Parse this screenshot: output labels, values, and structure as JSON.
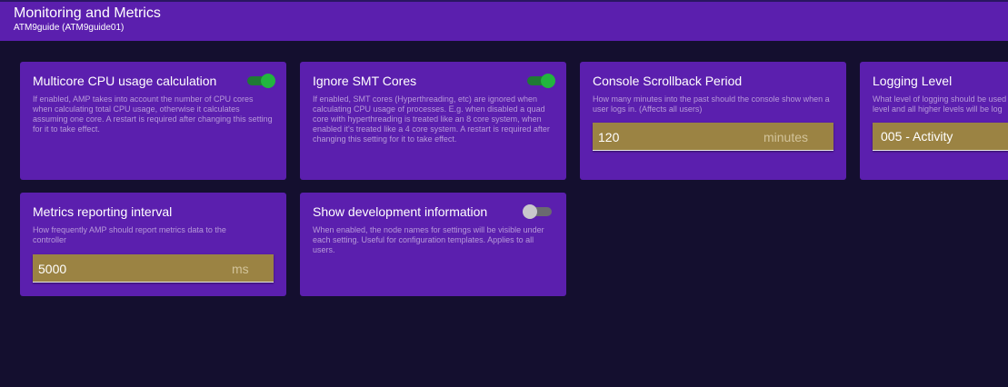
{
  "header": {
    "title": "Monitoring and Metrics",
    "subtitle": "ATM9guide (ATM9guide01)"
  },
  "settings": {
    "multicore_cpu": {
      "title": "Multicore CPU usage calculation",
      "description": "If enabled, AMP takes into account the number of CPU cores when calculating total CPU usage, otherwise it calculates assuming one core. A restart is required after changing this setting for it to take effect.",
      "enabled": true
    },
    "ignore_smt": {
      "title": "Ignore SMT Cores",
      "description": "If enabled, SMT cores (Hyperthreading, etc) are ignored when calculating CPU usage of processes. E.g. when disabled a quad core with hyperthreading is treated like an 8 core system, when enabled it's treated like a 4 core system. A restart is required after changing this setting for it to take effect.",
      "enabled": true
    },
    "console_scrollback": {
      "title": "Console Scrollback Period",
      "description": "How many minutes into the past should the console show when a user logs in. (Affects all users)",
      "value": "120",
      "unit": "minutes"
    },
    "logging_level": {
      "title": "Logging Level",
      "description": "What level of logging should be used level and all higher levels will be log",
      "selected": "005 - Activity"
    },
    "metrics_interval": {
      "title": "Metrics reporting interval",
      "description": "How frequently AMP should report metrics data to the controller",
      "value": "5000",
      "unit": "ms"
    },
    "dev_info": {
      "title": "Show development information",
      "description": "When enabled, the node names for settings will be visible under each setting. Useful for configuration templates. Applies to all users.",
      "enabled": false
    }
  },
  "colors": {
    "background": "#140f2f",
    "card": "#5b1fae",
    "toggle_on": "#22b53f",
    "input": "#9b8343"
  }
}
